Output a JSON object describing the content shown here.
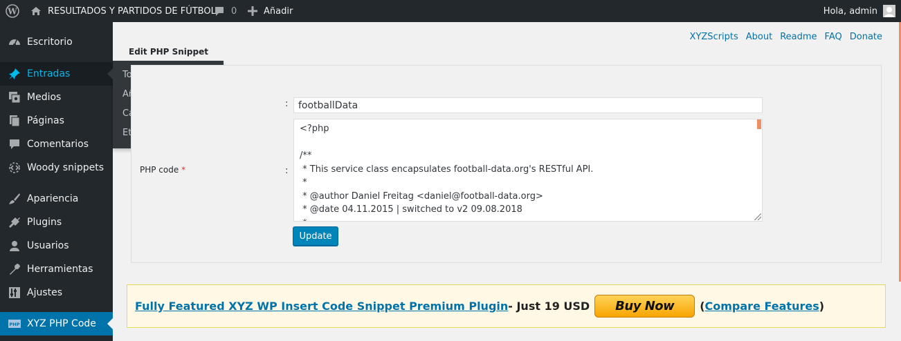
{
  "admin_bar": {
    "site_name": "RESULTADOS Y PARTIDOS DE FÚTBOL",
    "comments_count": "0",
    "add_new": "Añadir",
    "howdy": "Hola, admin"
  },
  "sidebar": {
    "items": [
      {
        "label": "Escritorio",
        "icon": "dashboard-icon"
      },
      {
        "label": "Entradas",
        "icon": "pushpin-icon"
      },
      {
        "label": "Medios",
        "icon": "media-icon"
      },
      {
        "label": "Páginas",
        "icon": "pages-icon"
      },
      {
        "label": "Comentarios",
        "icon": "comment-icon"
      },
      {
        "label": "Woody snippets",
        "icon": "snippet-icon"
      },
      {
        "label": "Apariencia",
        "icon": "brush-icon"
      },
      {
        "label": "Plugins",
        "icon": "plugin-icon"
      },
      {
        "label": "Usuarios",
        "icon": "user-icon"
      },
      {
        "label": "Herramientas",
        "icon": "wrench-icon"
      },
      {
        "label": "Ajustes",
        "icon": "settings-icon"
      },
      {
        "label": "XYZ PHP Code",
        "icon": "php-icon"
      }
    ],
    "flyout": [
      "Todas las entradas",
      "Añadir nueva",
      "Categorías",
      "Etiquetas"
    ]
  },
  "top_links": [
    "XYZScripts",
    "About",
    "Readme",
    "FAQ",
    "Donate"
  ],
  "page_title": "Edit PHP Snippet",
  "form": {
    "colon": ":",
    "name_value": "footballData",
    "code_label": "PHP code",
    "required_mark": "*",
    "code_lines": [
      "<?php",
      "",
      "/**",
      " * This service class encapsulates football-data.org's RESTful API.",
      " *",
      " * @author Daniel Freitag <daniel@football-data.org>",
      " * @date 04.11.2015 | switched to v2 09.08.2018",
      " *"
    ],
    "update_label": "Update"
  },
  "promo": {
    "link_text": "Fully Featured XYZ WP Insert Code Snippet Premium Plugin",
    "price_text": " - Just 19 USD",
    "buy_now": "Buy Now",
    "open_paren": "( ",
    "compare_text": "Compare Features",
    "close_paren": " )"
  },
  "colors": {
    "admin_bar": "#23282d",
    "accent": "#0073aa",
    "button": "#0085ba",
    "highlight": "#00b9eb"
  }
}
